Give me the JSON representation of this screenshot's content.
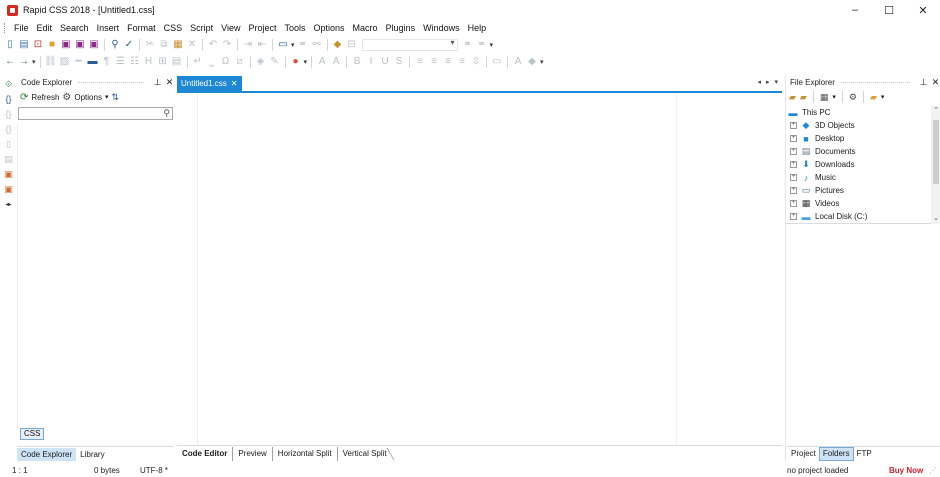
{
  "window": {
    "title": "Rapid CSS 2018 - [Untitled1.css]",
    "controls": [
      "–",
      "☐",
      "✕"
    ]
  },
  "menu": [
    "File",
    "Edit",
    "Search",
    "Insert",
    "Format",
    "CSS",
    "Script",
    "View",
    "Project",
    "Tools",
    "Options",
    "Macro",
    "Plugins",
    "Windows",
    "Help"
  ],
  "code_explorer": {
    "title": "Code Explorer",
    "refresh_label": "Refresh",
    "options_label": "Options",
    "search_placeholder": "",
    "language_tag": "CSS",
    "tabs": [
      "Code Explorer",
      "Library"
    ]
  },
  "editor": {
    "tab_label": "Untitled1.css",
    "view_tabs": [
      "Code Editor",
      "Preview",
      "Horizontal Split",
      "Vertical Split"
    ]
  },
  "file_explorer": {
    "title": "File Explorer",
    "root": "This PC",
    "items": [
      {
        "label": "3D Objects",
        "icon": "3d-objects-icon",
        "color": "#1e88d6"
      },
      {
        "label": "Desktop",
        "icon": "desktop-icon",
        "color": "#1e88d6"
      },
      {
        "label": "Documents",
        "icon": "documents-icon",
        "color": "#6a7a8a"
      },
      {
        "label": "Downloads",
        "icon": "downloads-icon",
        "color": "#1e88d6"
      },
      {
        "label": "Music",
        "icon": "music-icon",
        "color": "#1e88d6"
      },
      {
        "label": "Pictures",
        "icon": "pictures-icon",
        "color": "#4a6a8a"
      },
      {
        "label": "Videos",
        "icon": "videos-icon",
        "color": "#3a3a3a"
      },
      {
        "label": "Local Disk (C:)",
        "icon": "local-disk-icon",
        "color": "#4aa0e0"
      }
    ],
    "tabs": [
      "Project",
      "Folders",
      "FTP"
    ]
  },
  "status": {
    "position": "1 : 1",
    "size": "0 bytes",
    "encoding": "UTF-8 *",
    "project": "no project loaded",
    "buy": "Buy Now"
  },
  "colors": {
    "accent": "#1e88d6",
    "buy": "#d0202a",
    "active_tab": "#cfe3f6"
  }
}
